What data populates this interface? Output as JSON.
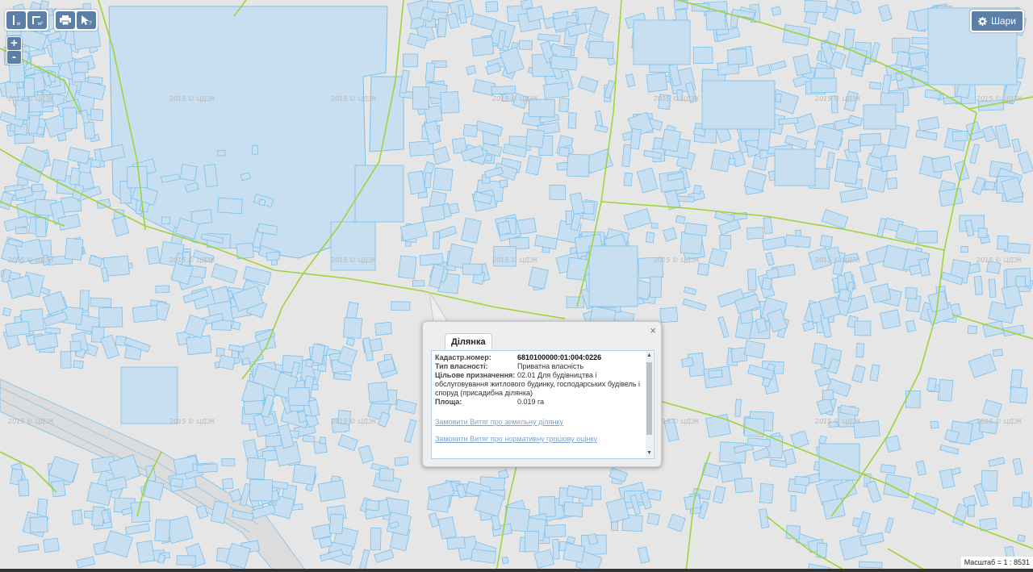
{
  "toolbar": {
    "buttons": [
      {
        "name": "measure-distance-icon",
        "tooltip_sub": "м"
      },
      {
        "name": "measure-area-icon",
        "tooltip_sub": "м²"
      },
      {
        "name": "print-icon"
      },
      {
        "name": "identify-icon"
      }
    ]
  },
  "zoom": {
    "plus": "+",
    "minus": "-"
  },
  "layers": {
    "label": "Шари",
    "icon": "gear-icon"
  },
  "watermark": "2015 © ЦДЗК",
  "popup": {
    "tab": "Ділянка",
    "close": "×",
    "fields": {
      "cadastral_label": "Кадастр.номер:",
      "cadastral_value": "6810100000:01:004:0226",
      "ownership_label": "Тип власності:",
      "ownership_value": "Приватна власність",
      "purpose_label": "Цільове призначення:",
      "purpose_value": "02.01 Для будівництва і обслуговування житлового будинку, господарських будівель і споруд (присадибна ділянка)",
      "area_label": "Площа:",
      "area_value": "0.019 га"
    },
    "links": {
      "extract": "Замовити Витяг про земельну ділянку",
      "valuation": "Замовити Витяг про нормативну грошову оцінку"
    }
  },
  "scale": "Масштаб = 1 : 8531",
  "colors": {
    "parcel_fill": "#c7dff0",
    "parcel_stroke": "#7cc0ec",
    "boundary": "#9fd33a",
    "background": "#e6e6e6",
    "button": "#5b7fa6"
  }
}
